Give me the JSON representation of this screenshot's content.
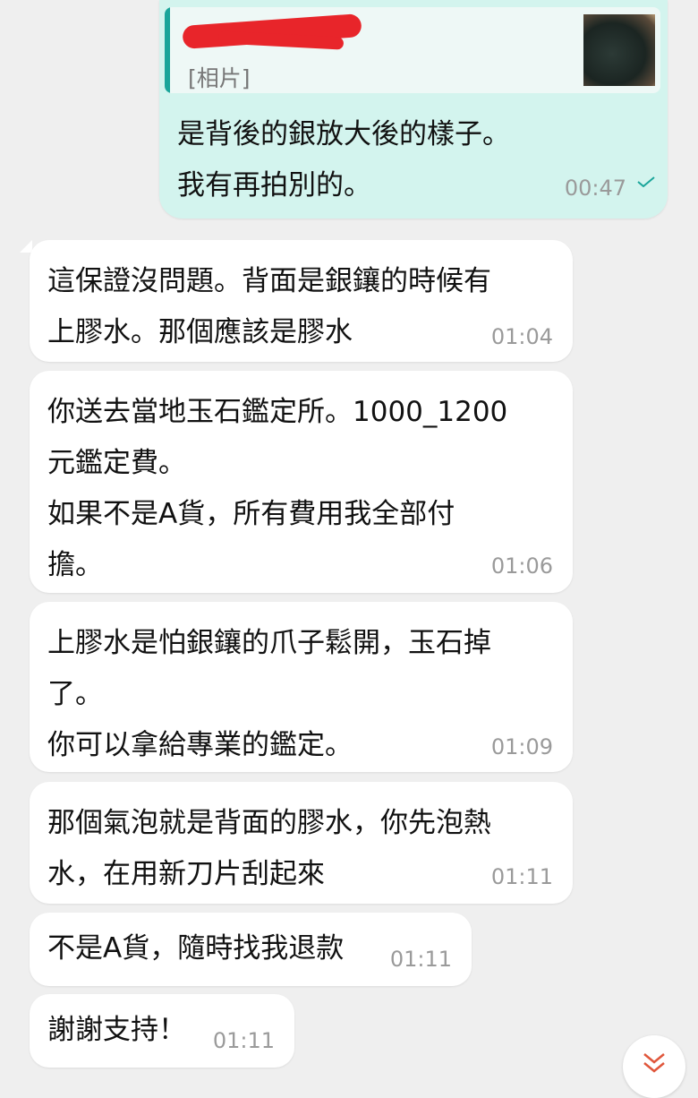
{
  "outgoing": {
    "quote_label": "[相片]",
    "text": "是背後的銀放大後的樣子。\n我有再拍別的。",
    "time": "00:47",
    "tick_color": "#1aa59a"
  },
  "incoming": [
    {
      "text": "這保證沒問題。背面是銀鑲的時候有\n上膠水。那個應該是膠水",
      "time": "01:04"
    },
    {
      "text": "你送去當地玉石鑑定所。1000_1200\n元鑑定費。\n如果不是A貨，所有費用我全部付\n擔。",
      "time": "01:06"
    },
    {
      "text": "上膠水是怕銀鑲的爪子鬆開，玉石掉\n了。\n你可以拿給專業的鑑定。",
      "time": "01:09"
    },
    {
      "text": "那個氣泡就是背面的膠水，你先泡熱\n水，在用新刀片刮起來",
      "time": "01:11"
    },
    {
      "text": "不是A貨，隨時找我退款",
      "time": "01:11"
    },
    {
      "text": "謝謝支持！",
      "time": "01:11"
    }
  ],
  "icons": {
    "scroll_down": "chevron-double-down-icon",
    "read_receipt": "check-icon"
  },
  "colors": {
    "outgoing_bubble": "#d3f4ee",
    "incoming_bubble": "#ffffff",
    "accent": "#1aa59a",
    "scroll_arrow": "#e0563b"
  }
}
